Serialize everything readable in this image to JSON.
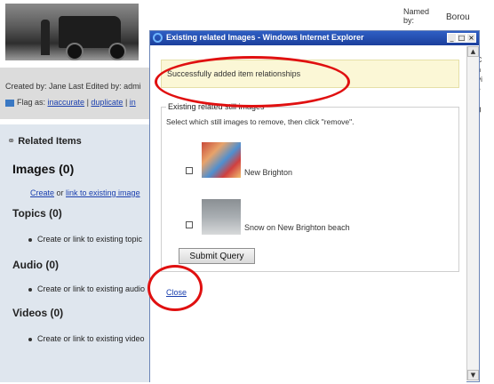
{
  "background_page": {
    "created_line": "Created by: Jane Last Edited by: admi",
    "flag": {
      "prefix": "Flag as:",
      "option_inaccurate": "inaccurate",
      "option_duplicate": "duplicate",
      "option_inappropriate": "in"
    },
    "right_header": {
      "named_label": "Named",
      "named_label_2": "by:",
      "borough_text": "Borou"
    },
    "right_strip_text": [
      "ns",
      "ad",
      "e C",
      "rch",
      "ervi",
      "ide",
      "",
      "org"
    ],
    "related": {
      "title": "Related Items",
      "images": {
        "heading": "Images (0)",
        "create_label": "Create",
        "or_label": " or ",
        "link_existing_label": "link to existing image"
      },
      "topics": {
        "heading": "Topics (0)",
        "item": "Create or link to existing topic"
      },
      "audio": {
        "heading": "Audio (0)",
        "item": "Create or link to existing audio"
      },
      "videos": {
        "heading": "Videos (0)",
        "item": "Create or link to existing video"
      }
    }
  },
  "popup": {
    "title": "Existing related Images - Windows Internet Explorer",
    "window_buttons": {
      "minimize": "_",
      "maximize": "□",
      "close": "×"
    },
    "success_message": "Successfully added item relationships",
    "fieldset_legend": "Existing related still images",
    "instruction": "Select which still images to remove, then click \"remove\".",
    "images": [
      {
        "label": "New Brighton"
      },
      {
        "label": "Snow on New Brighton beach"
      }
    ],
    "submit_label": "Submit Query",
    "close_label": "Close"
  },
  "colors": {
    "annotation_red": "#e01010",
    "titlebar_blue": "#1b3f9c",
    "success_bg": "#fbf7d6",
    "link_blue": "#1a3fae"
  }
}
